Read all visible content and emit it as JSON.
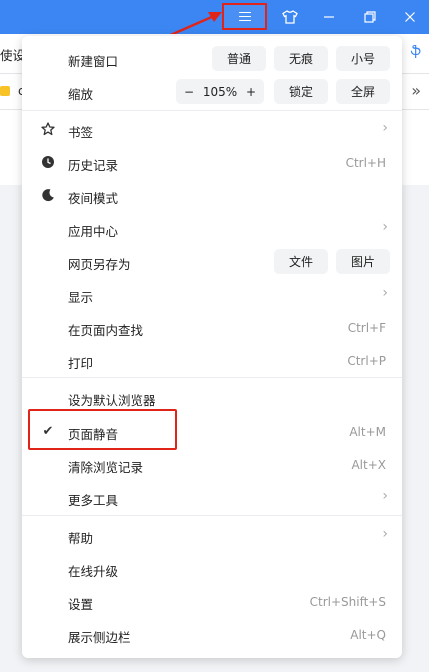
{
  "colors": {
    "titlebar": "#3b86f2",
    "highlight": "#e0241a",
    "menu_bg": "#ffffff"
  },
  "titlebar": {
    "buttons": [
      {
        "name": "menu-icon"
      },
      {
        "name": "skin-icon",
        "glyph": "👕"
      },
      {
        "name": "minimize-icon",
        "glyph": "—"
      },
      {
        "name": "restore-icon",
        "glyph": "❐"
      },
      {
        "name": "close-icon",
        "glyph": "✕"
      }
    ]
  },
  "background": {
    "addr_partial": "使设",
    "addr_right": "ֆ",
    "bookmark_partial": "c",
    "more_glyph": "»"
  },
  "menu": {
    "new_window": {
      "label": "新建窗口",
      "normal": "普通",
      "incognito": "无痕",
      "small": "小号"
    },
    "zoom": {
      "label": "缩放",
      "minus": "−",
      "value": "105%",
      "plus": "+",
      "lock": "锁定",
      "fullscreen": "全屏"
    },
    "bookmarks": {
      "label": "书签",
      "icon": "star-icon"
    },
    "history": {
      "label": "历史记录",
      "shortcut": "Ctrl+H",
      "icon": "clock-icon"
    },
    "night": {
      "label": "夜间模式",
      "icon": "moon-icon"
    },
    "apps": {
      "label": "应用中心"
    },
    "save_as": {
      "label": "网页另存为",
      "file": "文件",
      "image": "图片"
    },
    "display": {
      "label": "显示"
    },
    "find": {
      "label": "在页面内查找",
      "shortcut": "Ctrl+F"
    },
    "print": {
      "label": "打印",
      "shortcut": "Ctrl+P"
    },
    "default_browser": {
      "label": "设为默认浏览器"
    },
    "mute": {
      "label": "页面静音",
      "shortcut": "Alt+M",
      "checked": true
    },
    "clear_history": {
      "label": "清除浏览记录",
      "shortcut": "Alt+X"
    },
    "more_tools": {
      "label": "更多工具"
    },
    "help": {
      "label": "帮助"
    },
    "upgrade": {
      "label": "在线升级"
    },
    "settings": {
      "label": "设置",
      "shortcut": "Ctrl+Shift+S"
    },
    "sidebar": {
      "label": "展示侧边栏",
      "shortcut": "Alt+Q"
    }
  },
  "chevron": "›",
  "check": "✔"
}
